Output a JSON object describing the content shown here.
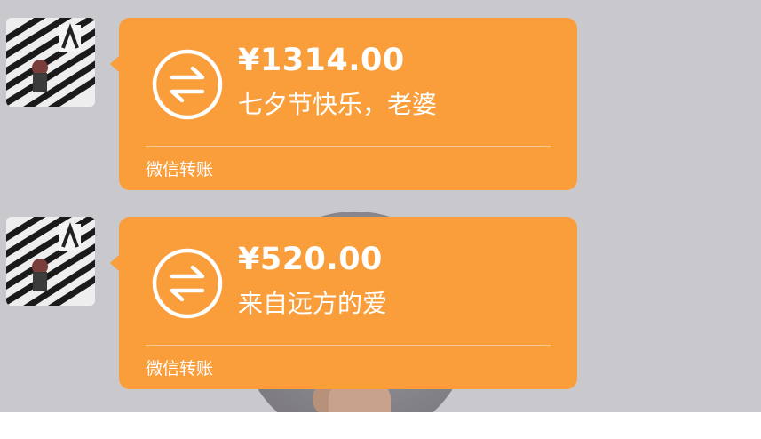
{
  "colors": {
    "bubble": "#fa9d3b",
    "chat_background": "#c9c8cc",
    "text": "#ffffff"
  },
  "messages": [
    {
      "type": "transfer",
      "icon": "transfer-icon",
      "amount": "¥1314.00",
      "memo": "七夕节快乐，老婆",
      "footer": "微信转账"
    },
    {
      "type": "transfer",
      "icon": "transfer-icon",
      "amount": "¥520.00",
      "memo": "来自远方的爱",
      "footer": "微信转账"
    }
  ]
}
